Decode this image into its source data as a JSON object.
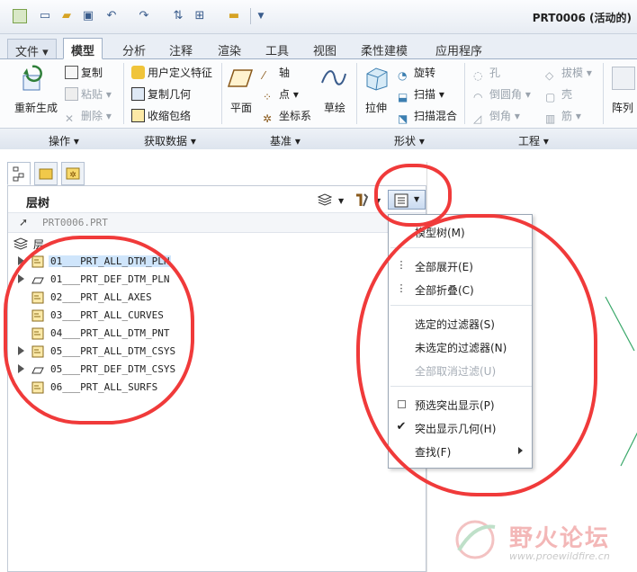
{
  "app": {
    "title": "PRT0006 (活动的)"
  },
  "tabs": [
    "文件",
    "模型",
    "分析",
    "注释",
    "渲染",
    "工具",
    "视图",
    "柔性建模",
    "应用程序"
  ],
  "ribbon": {
    "regen_label": "重新生成",
    "copy": "复制",
    "paste": "粘贴",
    "delete": "删除",
    "udf": "用户定义特征",
    "copy_geom": "复制几何",
    "shrinkwrap": "收缩包络",
    "plane": "平面",
    "axis": "轴",
    "point": "点",
    "csys": "坐标系",
    "sketch": "草绘",
    "extrude": "拉伸",
    "revolve": "旋转",
    "sweep": "扫描",
    "swept_blend": "扫描混合",
    "hole": "孔",
    "round": "倒圆角",
    "chamfer": "倒角",
    "draft": "拔模",
    "shell": "壳",
    "rib": "筋",
    "pattern": "阵列",
    "groups": [
      "操作",
      "获取数据",
      "基准",
      "形状",
      "工程"
    ]
  },
  "panel": {
    "title": "层树",
    "path": "PRT0006.PRT",
    "root": "层",
    "layers": [
      {
        "label": "01___PRT_ALL_DTM_PLN",
        "expandable": true,
        "selected": true
      },
      {
        "label": "01___PRT_DEF_DTM_PLN",
        "expandable": true,
        "selected": false
      },
      {
        "label": "02___PRT_ALL_AXES",
        "expandable": false,
        "selected": false
      },
      {
        "label": "03___PRT_ALL_CURVES",
        "expandable": false,
        "selected": false
      },
      {
        "label": "04___PRT_ALL_DTM_PNT",
        "expandable": false,
        "selected": false
      },
      {
        "label": "05___PRT_ALL_DTM_CSYS",
        "expandable": true,
        "selected": false
      },
      {
        "label": "05___PRT_DEF_DTM_CSYS",
        "expandable": true,
        "selected": false
      },
      {
        "label": "06___PRT_ALL_SURFS",
        "expandable": false,
        "selected": false
      }
    ]
  },
  "menu": {
    "model_tree": "模型树(M)",
    "expand_all": "全部展开(E)",
    "collapse_all": "全部折叠(C)",
    "selected_filter": "选定的过滤器(S)",
    "unselected_filter": "未选定的过滤器(N)",
    "clear_filter": "全部取消过滤(U)",
    "preselect_highlight": "预选突出显示(P)",
    "highlight_geom": "突出显示几何(H)",
    "find": "查找(F)"
  },
  "watermark": {
    "name": "野火论坛",
    "url": "www.proewildfire.cn"
  },
  "colors": {
    "annotation": "#f03a3a",
    "selection": "#cfe5fb",
    "accent": "#3a5c8c"
  }
}
